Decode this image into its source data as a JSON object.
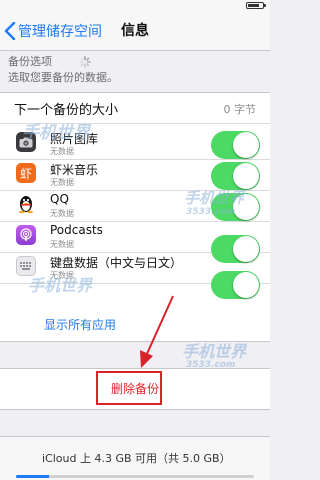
{
  "nav": {
    "back_label": "管理储存空间",
    "title": "信息"
  },
  "backup_options": {
    "label": "备份选项",
    "hint": "选取您要备份的数据。"
  },
  "next_backup": {
    "label": "下一个备份的大小",
    "value": "0 字节"
  },
  "apps": [
    {
      "name": "照片图库",
      "sub": "无数据",
      "icon": "camera-icon",
      "enabled": true
    },
    {
      "name": "虾米音乐",
      "sub": "无数据",
      "icon": "xiami-icon",
      "icon_glyph": "虾",
      "enabled": true
    },
    {
      "name": "QQ",
      "sub": "无数据",
      "icon": "qq-penguin-icon",
      "enabled": true
    },
    {
      "name": "Podcasts",
      "sub": "无数据",
      "icon": "podcasts-icon",
      "enabled": true
    },
    {
      "name": "键盘数据（中文与日文）",
      "sub": "无数据",
      "icon": "keyboard-icon",
      "enabled": true
    }
  ],
  "show_all_label": "显示所有应用",
  "delete_label": "删除备份",
  "storage": {
    "text": "iCloud 上 4.3 GB 可用（共 5.0 GB）",
    "used_fraction": 0.14
  },
  "watermarks": [
    "手机世界",
    "3533.com"
  ],
  "colors": {
    "accent": "#1e7bf2",
    "toggle_on": "#4cd964",
    "delete": "#e0232e",
    "highlight_box": "#d8232a"
  }
}
